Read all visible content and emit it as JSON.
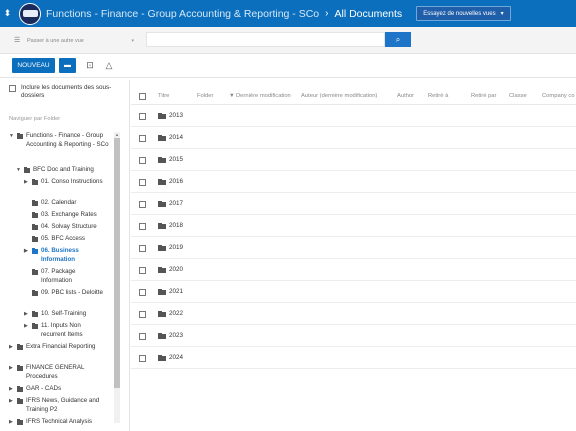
{
  "topbar": {
    "site_path": "Functions - Finance - Group Accounting & Reporting - SCo",
    "current": "All Documents",
    "try_views_label": "Essayez de nouvelles vues"
  },
  "searchbar": {
    "site_select_placeholder": "Passer à une autre vue",
    "search_placeholder": ""
  },
  "toolbar": {
    "new_label": "NOUVEAU"
  },
  "sidebar": {
    "include_subfolders": "Inclure les documents des sous-dossiers",
    "navigate_label": "Naviguer par Folder",
    "tree": [
      {
        "label": "Functions - Finance - Group Accounting & Reporting - SCo",
        "arrow": "▼"
      },
      {
        "label": "BFC Doc and Training",
        "arrow": "▼"
      },
      {
        "label": "01. Conso Instructions",
        "arrow": "▶"
      },
      {
        "label": "02. Calendar",
        "arrow": ""
      },
      {
        "label": "03. Exchange Rates",
        "arrow": ""
      },
      {
        "label": "04. Solvay Structure",
        "arrow": ""
      },
      {
        "label": "05. BFC Access",
        "arrow": ""
      },
      {
        "label": "06. Business Information",
        "arrow": "▶"
      },
      {
        "label": "07. Package Information",
        "arrow": ""
      },
      {
        "label": "09. PBC lists - Deloitte",
        "arrow": ""
      },
      {
        "label": "10. Self-Training",
        "arrow": "▶"
      },
      {
        "label": "11. Inputs Non recurrent Items",
        "arrow": "▶"
      },
      {
        "label": "Extra Financial Reporting",
        "arrow": "▶"
      },
      {
        "label": "FINANCE GENERAL Procedures",
        "arrow": "▶"
      },
      {
        "label": "GAR - CADs",
        "arrow": "▶"
      },
      {
        "label": "IFRS News, Guidance and Training P2",
        "arrow": "▶"
      },
      {
        "label": "IFRS Technical Analysis",
        "arrow": "▶"
      }
    ]
  },
  "list": {
    "columns": {
      "title": "Titre",
      "folder": "Folder",
      "modified": "Dernière modification",
      "author": "Auteur (dernière modification)",
      "author2": "Author",
      "retire": "Retiré à",
      "retire_par": "Retiré par",
      "classe": "Classe",
      "company": "Company co"
    },
    "sort_indicator": "▼",
    "rows": [
      "2013",
      "2014",
      "2015",
      "2016",
      "2017",
      "2018",
      "2019",
      "2020",
      "2021",
      "2022",
      "2023",
      "2024"
    ]
  }
}
